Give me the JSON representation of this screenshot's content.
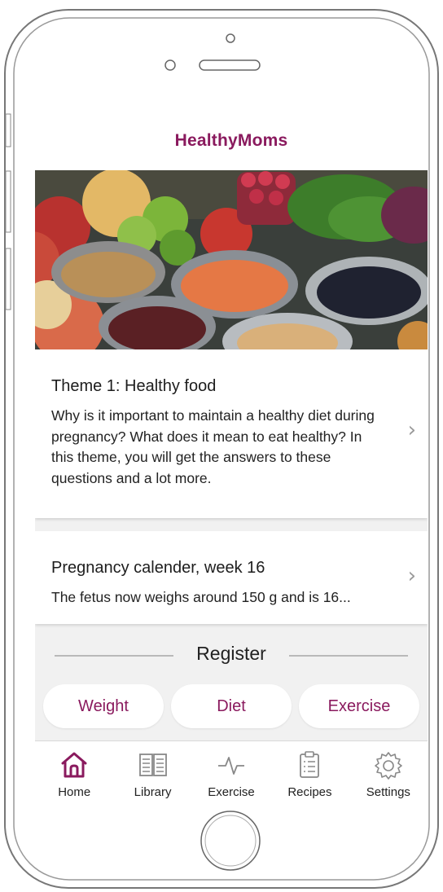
{
  "app": {
    "title": "HealthyMoms"
  },
  "hero": {
    "image_alt": "photo of fruits, vegetables and bowls of lentils, beans and chickpeas"
  },
  "theme_card": {
    "title": "Theme 1: Healthy food",
    "body": "Why is it important to maintain a healthy diet during pregnancy? What does it mean to eat healthy? In this theme, you will get the answers to these questions and a lot more.",
    "chevron_icon": "chevron-right-icon"
  },
  "calendar_card": {
    "title": "Pregnancy calender, week 16",
    "body": "The fetus now weighs around 150 g and is 16...",
    "chevron_icon": "chevron-right-icon"
  },
  "register": {
    "label": "Register",
    "buttons": [
      "Weight",
      "Diet",
      "Exercise"
    ]
  },
  "tabbar": {
    "items": [
      {
        "label": "Home",
        "icon": "home-icon",
        "active": true
      },
      {
        "label": "Library",
        "icon": "book-icon",
        "active": false
      },
      {
        "label": "Exercise",
        "icon": "pulse-icon",
        "active": false
      },
      {
        "label": "Recipes",
        "icon": "clipboard-icon",
        "active": false
      },
      {
        "label": "Settings",
        "icon": "gear-icon",
        "active": false
      }
    ]
  },
  "colors": {
    "accent": "#8a1a5e",
    "background": "#f1f1f1",
    "text": "#222222"
  }
}
